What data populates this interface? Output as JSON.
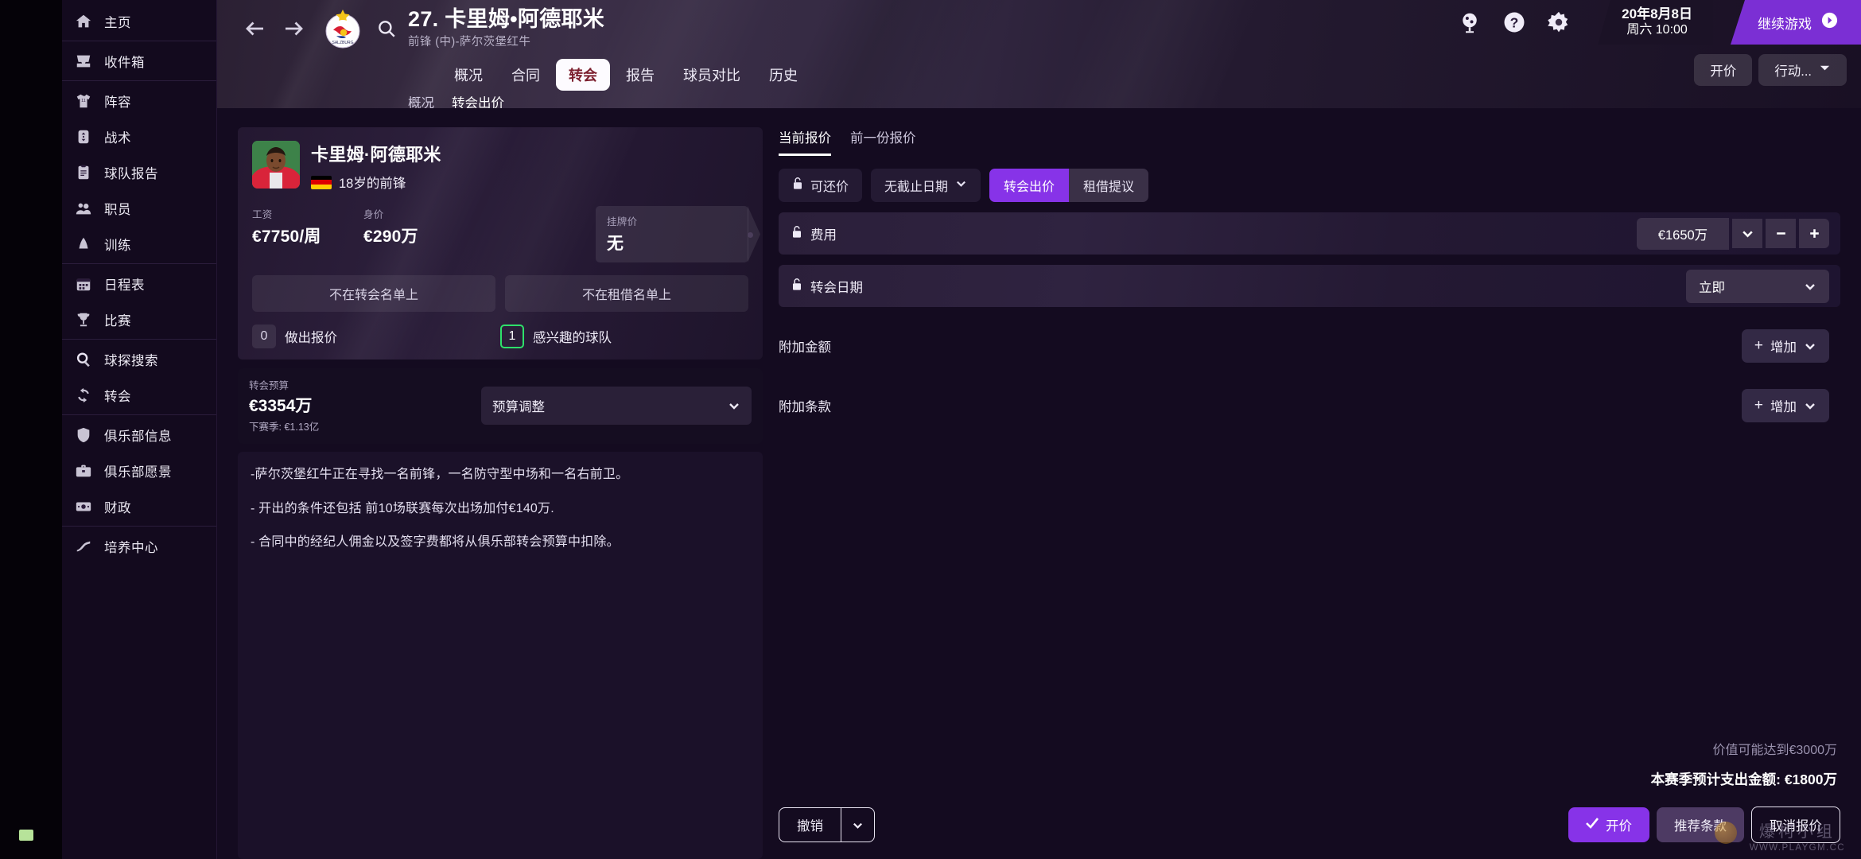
{
  "sidebar": {
    "groups": [
      {
        "items": [
          {
            "label": "主页",
            "icon": "home-icon"
          }
        ]
      },
      {
        "items": [
          {
            "label": "收件箱",
            "icon": "inbox-icon"
          }
        ]
      },
      {
        "items": [
          {
            "label": "阵容",
            "icon": "jersey-icon"
          },
          {
            "label": "战术",
            "icon": "tactics-icon"
          },
          {
            "label": "球队报告",
            "icon": "clipboard-icon"
          },
          {
            "label": "职员",
            "icon": "staff-icon"
          },
          {
            "label": "训练",
            "icon": "training-icon"
          }
        ]
      },
      {
        "items": [
          {
            "label": "日程表",
            "icon": "calendar-icon"
          },
          {
            "label": "比赛",
            "icon": "trophy-icon"
          }
        ]
      },
      {
        "items": [
          {
            "label": "球探搜索",
            "icon": "magnifier-icon"
          },
          {
            "label": "转会",
            "icon": "transfer-icon"
          }
        ]
      },
      {
        "items": [
          {
            "label": "俱乐部信息",
            "icon": "shield-icon"
          },
          {
            "label": "俱乐部愿景",
            "icon": "briefcase-icon"
          },
          {
            "label": "财政",
            "icon": "money-icon"
          }
        ]
      },
      {
        "items": [
          {
            "label": "培养中心",
            "icon": "development-icon"
          }
        ]
      }
    ]
  },
  "header": {
    "back_icon": "back-arrow-icon",
    "forward_icon": "forward-arrow-icon",
    "club_badge": "red-bull-salzburg-badge",
    "search_icon": "search-icon",
    "player_name": "27. 卡里姆•阿德耶米",
    "player_subtitle": "前锋 (中)-萨尔茨堡红牛",
    "tabs": [
      {
        "label": "概况",
        "active": false
      },
      {
        "label": "合同",
        "active": false
      },
      {
        "label": "转会",
        "active": true
      },
      {
        "label": "报告",
        "active": false
      },
      {
        "label": "球员对比",
        "active": false
      },
      {
        "label": "历史",
        "active": false
      }
    ],
    "sub_tabs": [
      {
        "label": "概况",
        "active": false
      },
      {
        "label": "转会出价",
        "active": true
      }
    ],
    "icons": [
      {
        "name": "globe-icon"
      },
      {
        "name": "help-icon"
      },
      {
        "name": "gear-icon"
      }
    ],
    "date_line1": "20年8月8日",
    "date_line2": "周六 10:00",
    "continue_label": "继续游戏",
    "continue_icon": "chevron-right-circle-icon",
    "action_buttons": [
      {
        "label": "开价",
        "icon": ""
      },
      {
        "label": "行动...",
        "icon": "chevron-down-icon"
      }
    ],
    "accent_purple": "#7b2fd4"
  },
  "player_card": {
    "portrait": "player-portrait",
    "name": "卡里姆·阿德耶米",
    "flag": "germany-flag",
    "meta": "18岁的前锋",
    "stats": [
      {
        "key": "工资",
        "value": "€7750/周"
      },
      {
        "key": "身价",
        "value": "€290万"
      }
    ],
    "tag": {
      "key": "挂牌价",
      "value": "无"
    },
    "list_buttons": [
      {
        "label": "不在转会名单上"
      },
      {
        "label": "不在租借名单上"
      }
    ],
    "counters": [
      {
        "count": "0",
        "label": "做出报价",
        "highlight": false
      },
      {
        "count": "1",
        "label": "感兴趣的球队",
        "highlight": true
      }
    ],
    "highlight_color": "#2ee06a"
  },
  "budget": {
    "key": "转会预算",
    "value": "€3354万",
    "sub": "下赛季: €1.13亿",
    "select_label": "预算调整",
    "select_icon": "chevron-down-icon"
  },
  "notes": [
    "-萨尔茨堡红牛正在寻找一名前锋，一名防守型中场和一名右前卫。",
    "-  开出的条件还包括 前10场联赛每次出场加付€140万.",
    "- 合同中的经纪人佣金以及签字费都将从俱乐部转会预算中扣除。"
  ],
  "offer": {
    "tabs": [
      {
        "label": "当前报价",
        "active": true
      },
      {
        "label": "前一份报价",
        "active": false
      }
    ],
    "pills": [
      {
        "label": "可还价",
        "icon": "lock-icon"
      },
      {
        "label": "无截止日期",
        "icon": "chevron-down-icon"
      }
    ],
    "segments": [
      {
        "label": "转会出价",
        "active": true
      },
      {
        "label": "租借提议",
        "active": false
      }
    ],
    "fields": [
      {
        "label": "费用",
        "icon": "lock-icon",
        "value": "€1650万",
        "controls": [
          "chevron-down-icon",
          "minus-icon",
          "plus-icon"
        ]
      },
      {
        "label": "转会日期",
        "icon": "lock-icon",
        "value": "立即",
        "controls": [
          "chevron-down-icon"
        ]
      }
    ],
    "extra_rows": [
      {
        "label": "附加金额",
        "button": "增加",
        "button_icon": "plus-icon",
        "chevron": "chevron-down-icon"
      },
      {
        "label": "附加条款",
        "button": "增加",
        "button_icon": "plus-icon",
        "chevron": "chevron-down-icon"
      }
    ],
    "footer_value_note": "价值可能达到€3000万",
    "footer_total": "本赛季预计支出金额: €1800万",
    "undo_label": "撤销",
    "undo_chevron": "chevron-down-icon",
    "buttons": [
      {
        "label": "开价",
        "style": "primary",
        "icon": "check-icon"
      },
      {
        "label": "推荐条款",
        "style": "secondary",
        "icon": ""
      },
      {
        "label": "取消报价",
        "style": "outline",
        "icon": ""
      }
    ]
  },
  "watermark": {
    "text": "爆柯小组",
    "url": "WWW.PLAYGM.CC"
  }
}
